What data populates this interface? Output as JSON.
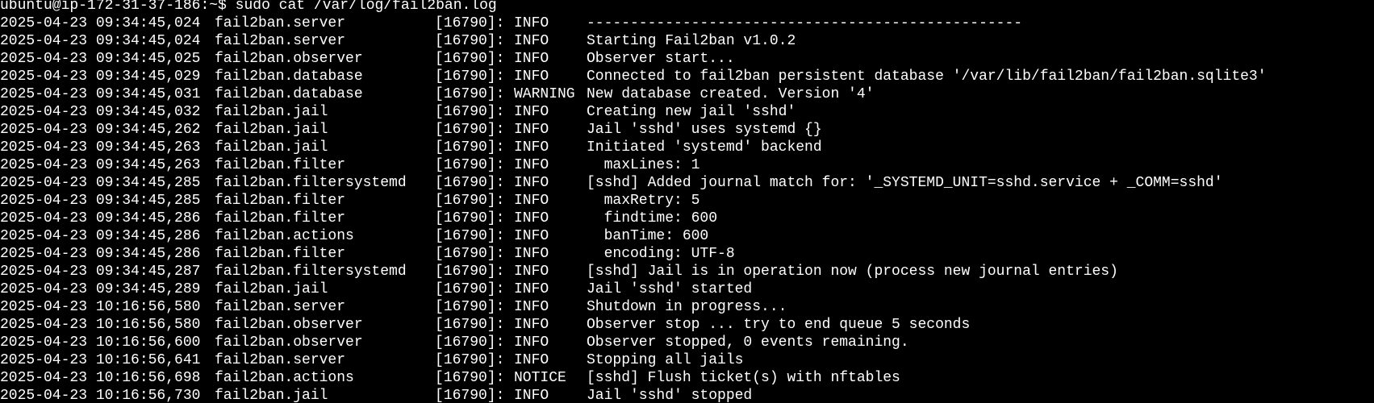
{
  "terminal": {
    "prompt": "ubuntu@ip-172-31-37-186:~$",
    "command": "sudo cat /var/log/fail2ban.log",
    "lines": [
      {
        "ts": "2025-04-23 09:34:45,024",
        "logger": "fail2ban.server",
        "pid": "[16790]:",
        "level": "INFO",
        "msg": "--------------------------------------------------"
      },
      {
        "ts": "2025-04-23 09:34:45,024",
        "logger": "fail2ban.server",
        "pid": "[16790]:",
        "level": "INFO",
        "msg": "Starting Fail2ban v1.0.2"
      },
      {
        "ts": "2025-04-23 09:34:45,025",
        "logger": "fail2ban.observer",
        "pid": "[16790]:",
        "level": "INFO",
        "msg": "Observer start..."
      },
      {
        "ts": "2025-04-23 09:34:45,029",
        "logger": "fail2ban.database",
        "pid": "[16790]:",
        "level": "INFO",
        "msg": "Connected to fail2ban persistent database '/var/lib/fail2ban/fail2ban.sqlite3'"
      },
      {
        "ts": "2025-04-23 09:34:45,031",
        "logger": "fail2ban.database",
        "pid": "[16790]:",
        "level": "WARNING",
        "msg": "New database created. Version '4'"
      },
      {
        "ts": "2025-04-23 09:34:45,032",
        "logger": "fail2ban.jail",
        "pid": "[16790]:",
        "level": "INFO",
        "msg": "Creating new jail 'sshd'"
      },
      {
        "ts": "2025-04-23 09:34:45,262",
        "logger": "fail2ban.jail",
        "pid": "[16790]:",
        "level": "INFO",
        "msg": "Jail 'sshd' uses systemd {}"
      },
      {
        "ts": "2025-04-23 09:34:45,263",
        "logger": "fail2ban.jail",
        "pid": "[16790]:",
        "level": "INFO",
        "msg": "Initiated 'systemd' backend"
      },
      {
        "ts": "2025-04-23 09:34:45,263",
        "logger": "fail2ban.filter",
        "pid": "[16790]:",
        "level": "INFO",
        "msg": "  maxLines: 1"
      },
      {
        "ts": "2025-04-23 09:34:45,285",
        "logger": "fail2ban.filtersystemd",
        "pid": "[16790]:",
        "level": "INFO",
        "msg": "[sshd] Added journal match for: '_SYSTEMD_UNIT=sshd.service + _COMM=sshd'"
      },
      {
        "ts": "2025-04-23 09:34:45,285",
        "logger": "fail2ban.filter",
        "pid": "[16790]:",
        "level": "INFO",
        "msg": "  maxRetry: 5"
      },
      {
        "ts": "2025-04-23 09:34:45,286",
        "logger": "fail2ban.filter",
        "pid": "[16790]:",
        "level": "INFO",
        "msg": "  findtime: 600"
      },
      {
        "ts": "2025-04-23 09:34:45,286",
        "logger": "fail2ban.actions",
        "pid": "[16790]:",
        "level": "INFO",
        "msg": "  banTime: 600"
      },
      {
        "ts": "2025-04-23 09:34:45,286",
        "logger": "fail2ban.filter",
        "pid": "[16790]:",
        "level": "INFO",
        "msg": "  encoding: UTF-8"
      },
      {
        "ts": "2025-04-23 09:34:45,287",
        "logger": "fail2ban.filtersystemd",
        "pid": "[16790]:",
        "level": "INFO",
        "msg": "[sshd] Jail is in operation now (process new journal entries)"
      },
      {
        "ts": "2025-04-23 09:34:45,289",
        "logger": "fail2ban.jail",
        "pid": "[16790]:",
        "level": "INFO",
        "msg": "Jail 'sshd' started"
      },
      {
        "ts": "2025-04-23 10:16:56,580",
        "logger": "fail2ban.server",
        "pid": "[16790]:",
        "level": "INFO",
        "msg": "Shutdown in progress..."
      },
      {
        "ts": "2025-04-23 10:16:56,580",
        "logger": "fail2ban.observer",
        "pid": "[16790]:",
        "level": "INFO",
        "msg": "Observer stop ... try to end queue 5 seconds"
      },
      {
        "ts": "2025-04-23 10:16:56,600",
        "logger": "fail2ban.observer",
        "pid": "[16790]:",
        "level": "INFO",
        "msg": "Observer stopped, 0 events remaining."
      },
      {
        "ts": "2025-04-23 10:16:56,641",
        "logger": "fail2ban.server",
        "pid": "[16790]:",
        "level": "INFO",
        "msg": "Stopping all jails"
      },
      {
        "ts": "2025-04-23 10:16:56,698",
        "logger": "fail2ban.actions",
        "pid": "[16790]:",
        "level": "NOTICE",
        "msg": "[sshd] Flush ticket(s) with nftables"
      },
      {
        "ts": "2025-04-23 10:16:56,730",
        "logger": "fail2ban.jail",
        "pid": "[16790]:",
        "level": "INFO",
        "msg": "Jail 'sshd' stopped"
      }
    ]
  }
}
